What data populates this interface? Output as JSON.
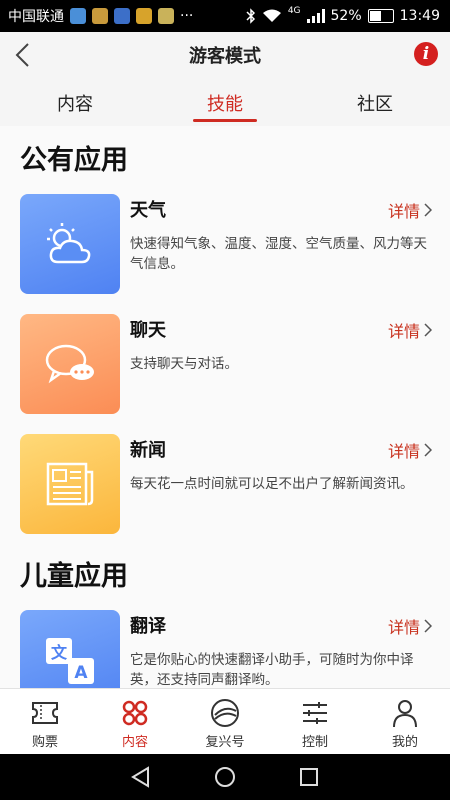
{
  "status_bar": {
    "carrier": "中国联通",
    "dots": "···",
    "network": "4G",
    "battery": "52%",
    "battery_level": 0.52,
    "time": "13:49"
  },
  "header": {
    "title": "游客模式",
    "info_glyph": "i"
  },
  "tabs": [
    {
      "label": "内容",
      "active": false
    },
    {
      "label": "技能",
      "active": true
    },
    {
      "label": "社区",
      "active": false
    }
  ],
  "sections": [
    {
      "title": "公有应用",
      "apps": [
        {
          "name": "天气",
          "desc": "快速得知气象、温度、湿度、空气质量、风力等天气信息。",
          "detail": "详情",
          "icon": "weather-icon",
          "color_from": "#7aa8fb",
          "color_to": "#4f82f2"
        },
        {
          "name": "聊天",
          "desc": "支持聊天与对话。",
          "detail": "详情",
          "icon": "chat-icon",
          "color_from": "#ffb884",
          "color_to": "#fb8d55"
        },
        {
          "name": "新闻",
          "desc": "每天花一点时间就可以足不出户了解新闻资讯。",
          "detail": "详情",
          "icon": "news-icon",
          "color_from": "#ffd978",
          "color_to": "#fbb63c"
        }
      ]
    },
    {
      "title": "儿童应用",
      "apps": [
        {
          "name": "翻译",
          "desc": "它是你贴心的快速翻译小助手，可随时为你中译英，还支持同声翻译哟。",
          "detail": "详情",
          "icon": "translate-icon",
          "color_from": "#7aa8fb",
          "color_to": "#4f82f2"
        }
      ]
    }
  ],
  "bottom_nav": [
    {
      "label": "购票",
      "icon": "ticket-icon",
      "active": false
    },
    {
      "label": "内容",
      "icon": "content-grid-icon",
      "active": true
    },
    {
      "label": "复兴号",
      "icon": "fuxing-logo-icon",
      "active": false
    },
    {
      "label": "控制",
      "icon": "sliders-icon",
      "active": false
    },
    {
      "label": "我的",
      "icon": "user-icon",
      "active": false
    }
  ],
  "colors": {
    "accent": "#cf2b22",
    "detail": "#c8321f"
  }
}
